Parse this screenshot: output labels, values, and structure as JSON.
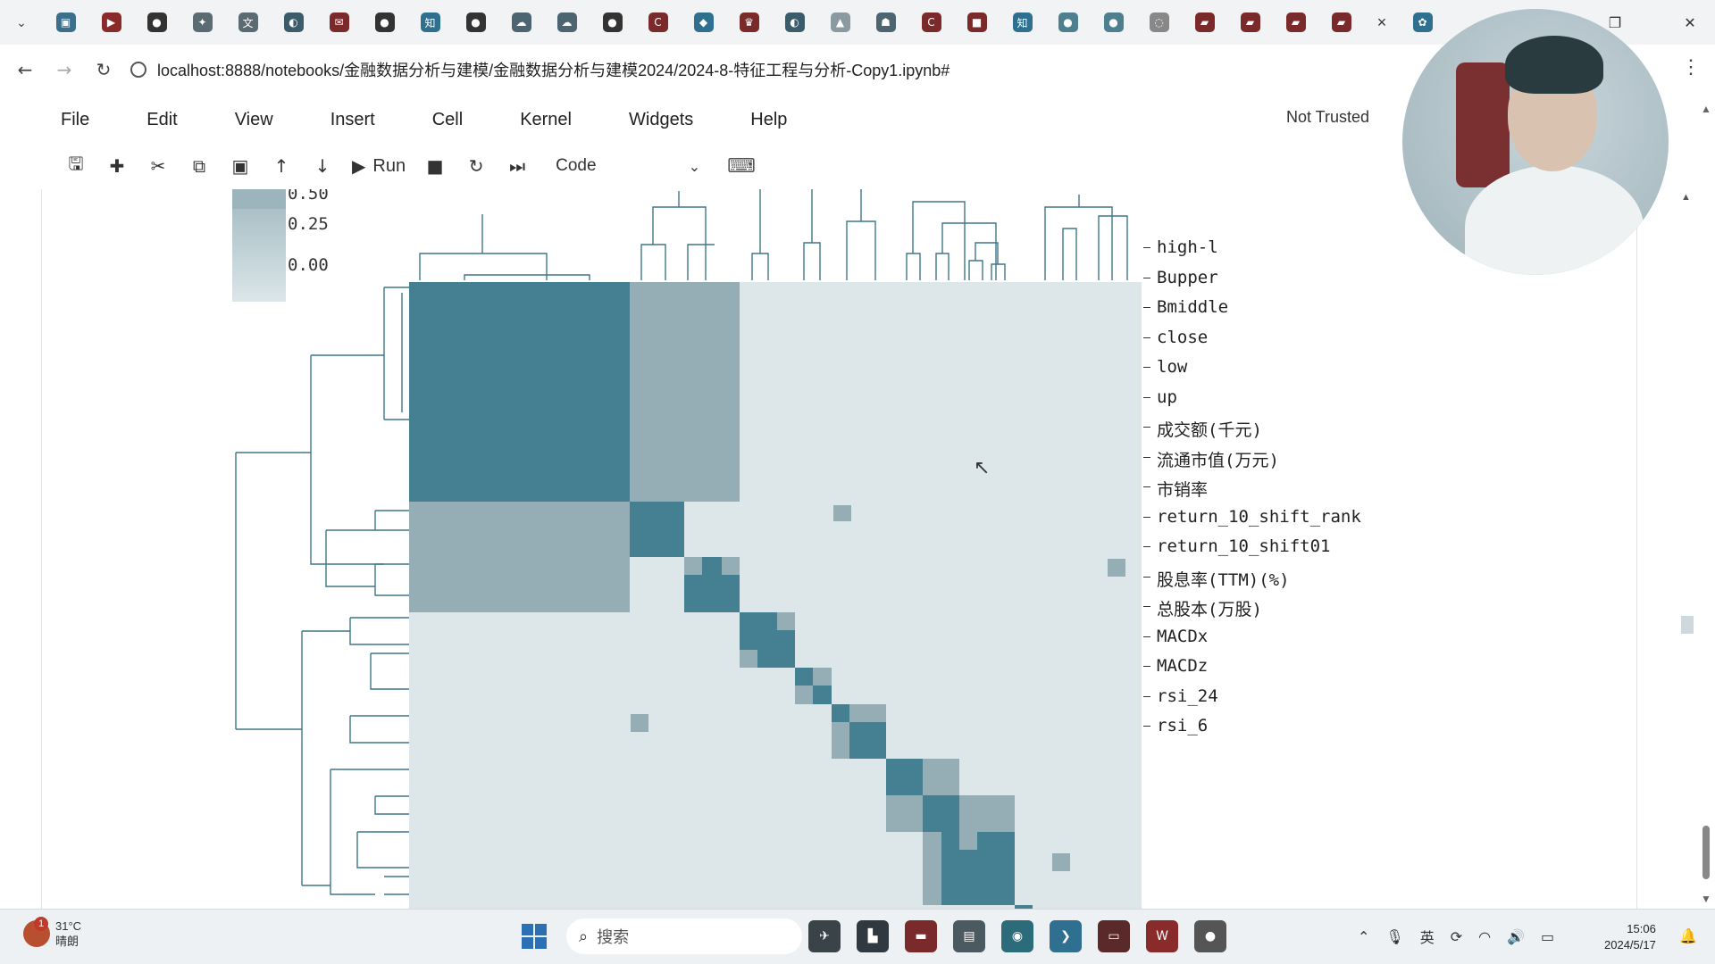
{
  "browser": {
    "tab_menu_icon": "chevron-down-icon",
    "tab_icons": [
      {
        "name": "bilibili-icon",
        "glyph": "▣",
        "color": "#3c6f8a"
      },
      {
        "name": "youtube-icon",
        "glyph": "▶",
        "color": "#8a2b2b"
      },
      {
        "name": "github-icon",
        "glyph": "●",
        "color": "#333333"
      },
      {
        "name": "extension-icon",
        "glyph": "✦",
        "color": "#5a6b73"
      },
      {
        "name": "translate-icon",
        "glyph": "文",
        "color": "#5a6b73"
      },
      {
        "name": "globe-icon",
        "glyph": "◐",
        "color": "#3b5c6b"
      },
      {
        "name": "mail-icon",
        "glyph": "✉",
        "color": "#7a2a2a"
      },
      {
        "name": "github-icon",
        "glyph": "●",
        "color": "#333333"
      },
      {
        "name": "zhihu-icon",
        "glyph": "知",
        "color": "#2f6f8f"
      },
      {
        "name": "github-icon",
        "glyph": "●",
        "color": "#333333"
      },
      {
        "name": "cloud-icon",
        "glyph": "☁",
        "color": "#4d6570"
      },
      {
        "name": "cloud-icon",
        "glyph": "☁",
        "color": "#4d6570"
      },
      {
        "name": "github-icon",
        "glyph": "●",
        "color": "#333333"
      },
      {
        "name": "c-icon",
        "glyph": "C",
        "color": "#7a2a2a"
      },
      {
        "name": "chat-icon",
        "glyph": "◆",
        "color": "#2f6f8f"
      },
      {
        "name": "crown-icon",
        "glyph": "♛",
        "color": "#7a2a2a"
      },
      {
        "name": "globe-icon",
        "glyph": "◐",
        "color": "#3b5c6b"
      },
      {
        "name": "mountain-icon",
        "glyph": "▲",
        "color": "#8a9aa0"
      },
      {
        "name": "robot-icon",
        "glyph": "☗",
        "color": "#4d6570"
      },
      {
        "name": "c-icon",
        "glyph": "C",
        "color": "#7a2a2a"
      },
      {
        "name": "video-icon",
        "glyph": "■",
        "color": "#7a2a2a"
      },
      {
        "name": "zhihu-icon",
        "glyph": "知",
        "color": "#2f6f8f"
      },
      {
        "name": "sphere-icon",
        "glyph": "●",
        "color": "#4d7f8f"
      },
      {
        "name": "sphere-icon",
        "glyph": "●",
        "color": "#4d7f8f"
      },
      {
        "name": "loading-icon",
        "glyph": "◌",
        "color": "#888888"
      },
      {
        "name": "doc-icon",
        "glyph": "▰",
        "color": "#7a2a2a"
      },
      {
        "name": "doc-icon",
        "glyph": "▰",
        "color": "#7a2a2a"
      },
      {
        "name": "doc-icon",
        "glyph": "▰",
        "color": "#7a2a2a"
      },
      {
        "name": "doc-icon",
        "glyph": "▰",
        "color": "#7a2a2a"
      }
    ],
    "tab_close": "×",
    "active_tab_icon": "paw-icon",
    "url": "localhost:8888/notebooks/金融数据分析与建模/金融数据分析与建模2024/2024-8-特征工程与分析-Copy1.ipynb#"
  },
  "jupyter": {
    "menu": [
      "File",
      "Edit",
      "View",
      "Insert",
      "Cell",
      "Kernel",
      "Widgets",
      "Help"
    ],
    "trust_status": "Not Trusted",
    "toolbar": {
      "run_label": "Run",
      "cell_type": "Code"
    }
  },
  "chart_data": {
    "type": "heatmap",
    "title": "",
    "colorbar_ticks": [
      "0.50",
      "0.25",
      "0.00"
    ],
    "row_labels": [
      "high-l",
      "Bupper",
      "Bmiddle",
      "close",
      "low",
      "up",
      "成交额(千元)",
      "流通市值(万元)",
      "市销率",
      "return_10_shift_rank",
      "return_10_shift01",
      "股息率(TTM)(%)",
      "总股本(万股)",
      "MACDx",
      "MACDz",
      "rsi_24",
      "rsi_6"
    ],
    "colors": {
      "high": "#457f92",
      "mid": "#95adb5",
      "low": "#dde7ea",
      "dendrogram": "#3f7787"
    }
  },
  "taskbar": {
    "weather_temp": "31°C",
    "weather_desc": "晴朗",
    "weather_badge": "1",
    "search_placeholder": "搜索",
    "time": "15:06",
    "date": "2024/5/17"
  }
}
